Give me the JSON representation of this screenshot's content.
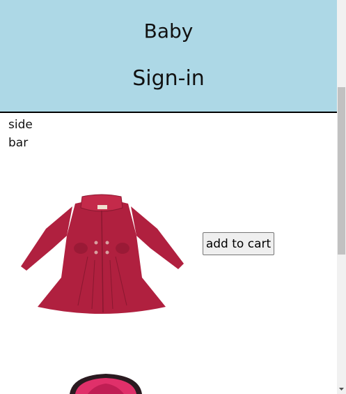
{
  "header": {
    "title": "Baby",
    "signin_label": "Sign-in",
    "background": "#add8e6"
  },
  "sidebar": {
    "line1": "side",
    "line2": "bar"
  },
  "products": [
    {
      "image_icon": "red-baby-coat-image",
      "button_label": "add to cart"
    },
    {
      "image_icon": "pink-baby-hat-image"
    }
  ],
  "colors": {
    "coat": "#b0203f",
    "hat": "#e0306a"
  }
}
